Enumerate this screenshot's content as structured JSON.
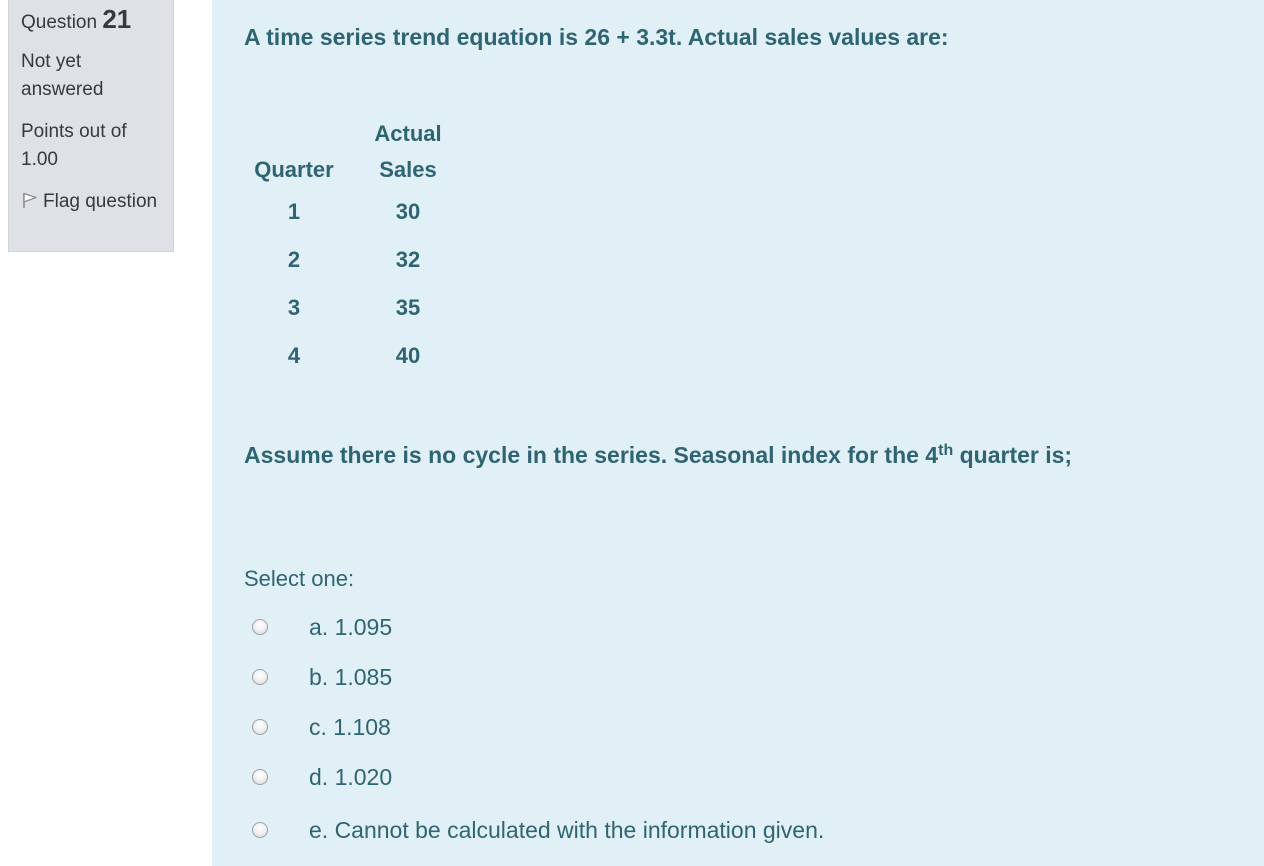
{
  "info": {
    "question_label": "Question",
    "question_number": "21",
    "state": "Not yet answered",
    "grade": "Points out of 1.00",
    "flag_label": "Flag question"
  },
  "question": {
    "text": "A time series trend equation is 26 + 3.3t.  Actual sales values are:",
    "table": {
      "headers": [
        "Quarter",
        "Actual Sales"
      ],
      "rows": [
        [
          "1",
          "30"
        ],
        [
          "2",
          "32"
        ],
        [
          "3",
          "35"
        ],
        [
          "4",
          "40"
        ]
      ]
    },
    "assume_before": "Assume there is no cycle in the series.  Seasonal index for the 4",
    "assume_sup": "th",
    "assume_after": " quarter is;",
    "prompt": "Select one:",
    "options": [
      {
        "label": "a. 1.095",
        "selected": false
      },
      {
        "label": "b. 1.085",
        "selected": false
      },
      {
        "label": "c. 1.108",
        "selected": false
      },
      {
        "label": "d. 1.020",
        "selected": false
      },
      {
        "label": "e. Cannot be calculated with the information given.",
        "selected": false
      }
    ]
  },
  "colors": {
    "content_bg": "#e1f0f7",
    "info_bg": "#dee2e6",
    "question_text": "#2f6473"
  }
}
